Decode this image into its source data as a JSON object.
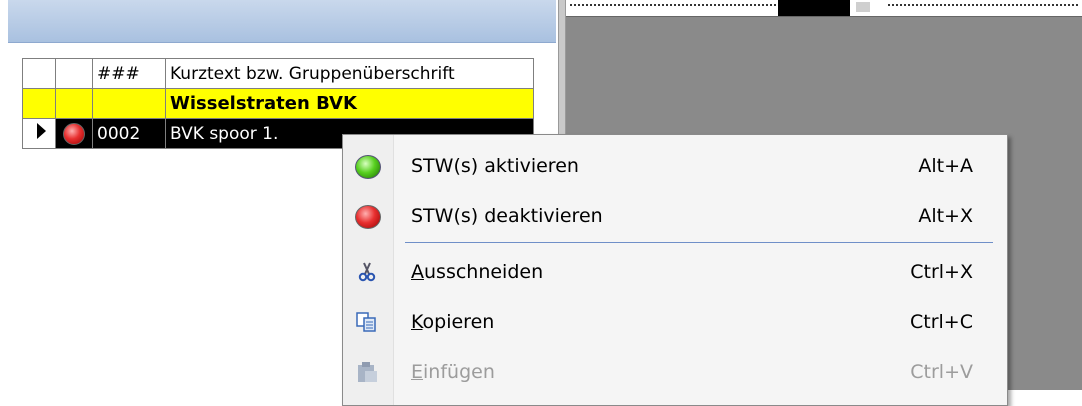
{
  "grid": {
    "header": {
      "marker": "",
      "status": "",
      "number": "###",
      "text": "Kurztext bzw. Gruppenüberschrift"
    },
    "rows": [
      {
        "marker": "",
        "status": "",
        "number": "",
        "text": "Wisselstraten BVK",
        "type": "group"
      },
      {
        "marker": "current-row-arrow-icon",
        "status": "red-status-icon",
        "number": "0002",
        "text": "BVK spoor 1.",
        "type": "selected"
      }
    ]
  },
  "context_menu": {
    "items": [
      {
        "icon": "green-status-icon",
        "label": "STW(s) aktivieren",
        "shortcut": "Alt+A",
        "enabled": true
      },
      {
        "icon": "red-status-icon",
        "label": "STW(s) deaktivieren",
        "shortcut": "Alt+X",
        "enabled": true
      },
      {
        "icon": "scissors-icon",
        "label_mnemonic": "A",
        "label_rest": "usschneiden",
        "shortcut": "Ctrl+X",
        "enabled": true
      },
      {
        "icon": "copy-icon",
        "label_mnemonic": "K",
        "label_rest": "opieren",
        "shortcut": "Ctrl+C",
        "enabled": true
      },
      {
        "icon": "paste-icon",
        "label_mnemonic": "E",
        "label_rest": "infügen",
        "shortcut": "Ctrl+V",
        "enabled": false
      }
    ]
  },
  "colors": {
    "group_row": "#ffff00",
    "selected_row": "#000000",
    "menu_separator": "#6f8fc8",
    "right_pane": "#8a8a8a"
  }
}
